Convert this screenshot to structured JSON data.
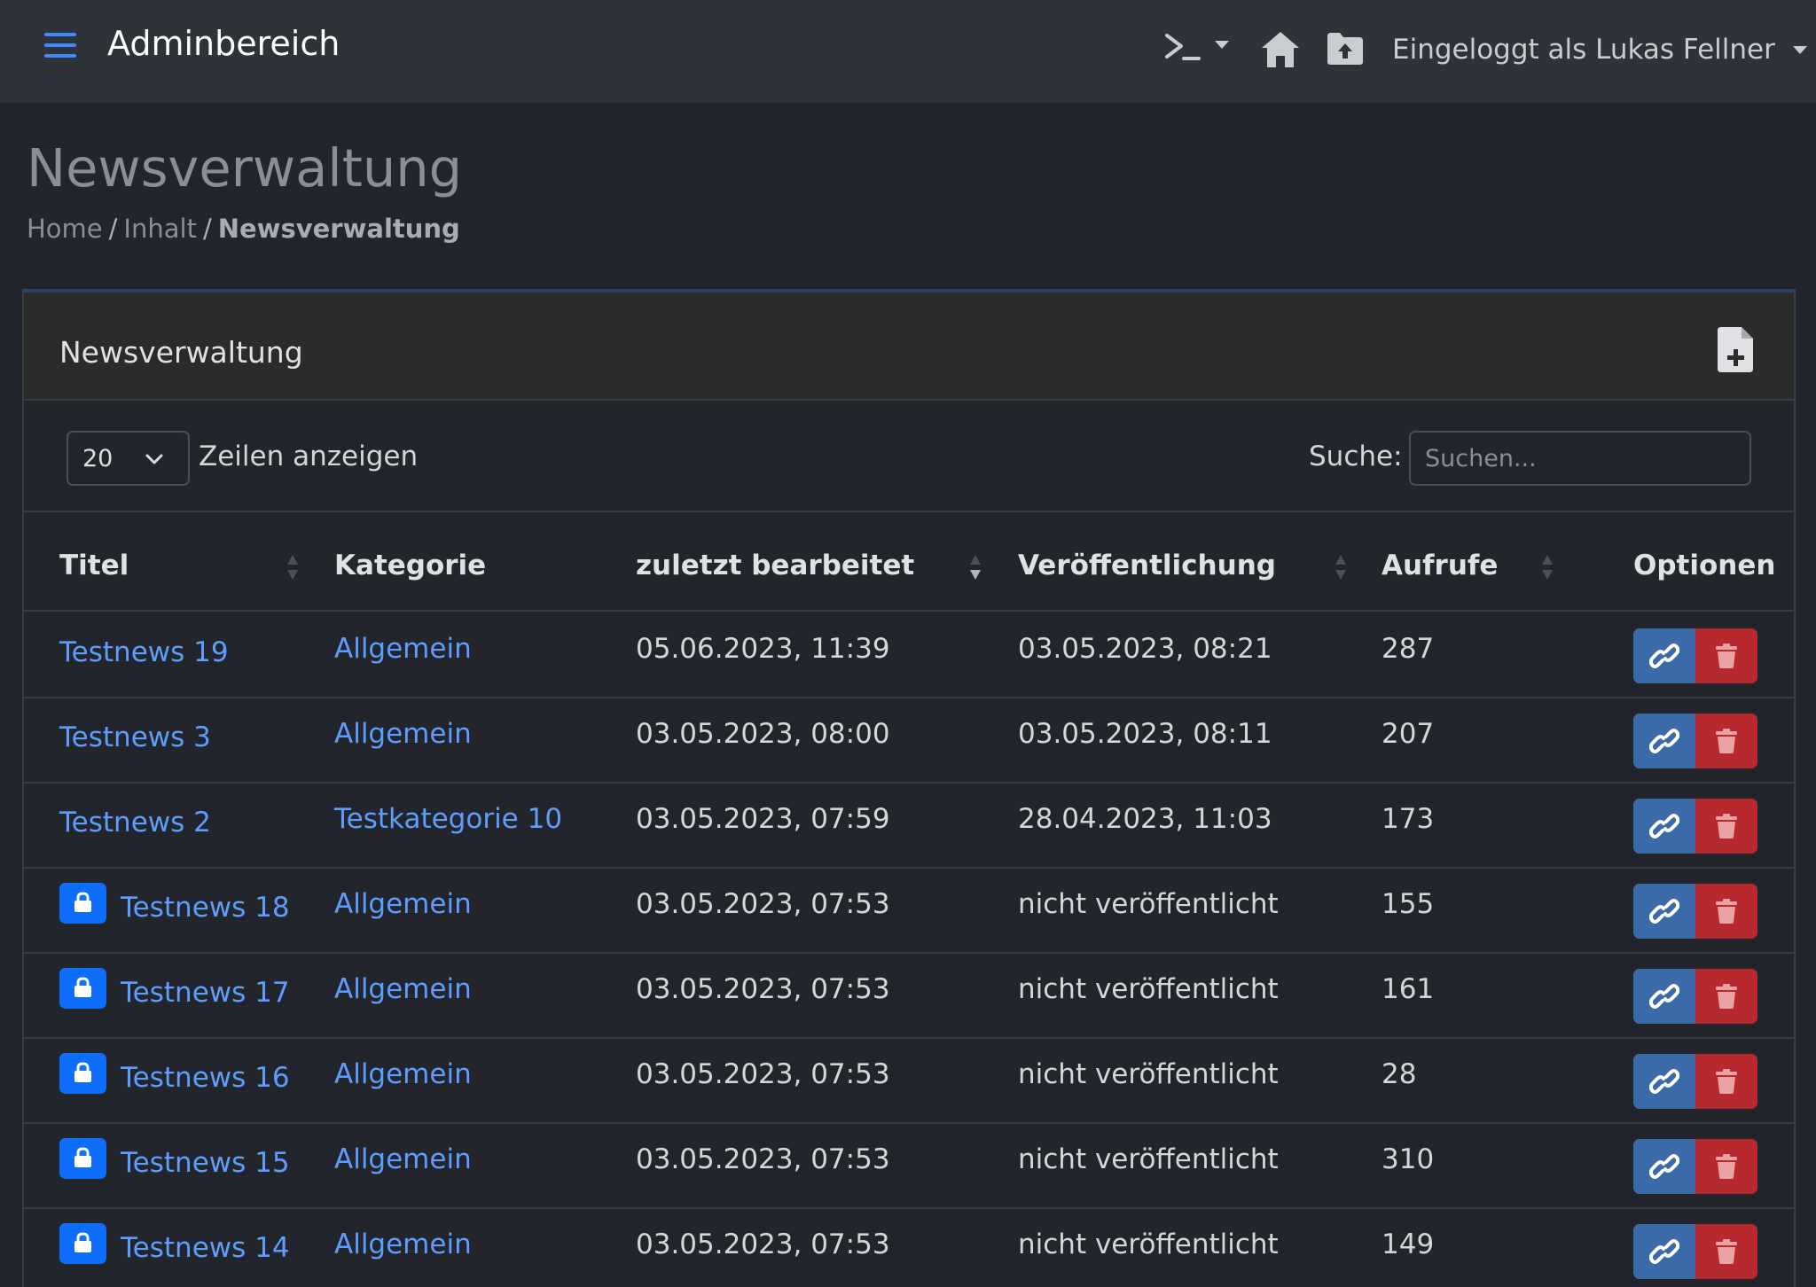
{
  "navbar": {
    "title": "Adminbereich",
    "user_label": "Eingeloggt als Lukas Fellner",
    "icons": [
      "menu-icon",
      "terminal-icon",
      "home-icon",
      "folder-upload-icon"
    ]
  },
  "page": {
    "title": "Newsverwaltung",
    "breadcrumb": [
      "Home",
      "Inhalt",
      "Newsverwaltung"
    ]
  },
  "card": {
    "title": "Newsverwaltung",
    "add_icon": "file-plus-icon"
  },
  "controls": {
    "length_value": "20",
    "length_label": "Zeilen anzeigen",
    "search_label": "Suche:",
    "search_placeholder": "Suchen...",
    "search_value": ""
  },
  "table": {
    "columns": [
      "Titel",
      "Kategorie",
      "zuletzt bearbeitet",
      "Veröffentlichung",
      "Aufrufe",
      "Optionen"
    ],
    "rows": [
      {
        "locked": false,
        "title": "Testnews 19",
        "category": "Allgemein",
        "edited": "05.06.2023, 11:39",
        "published": "03.05.2023, 08:21",
        "views": "287"
      },
      {
        "locked": false,
        "title": "Testnews 3",
        "category": "Allgemein",
        "edited": "03.05.2023, 08:00",
        "published": "03.05.2023, 08:11",
        "views": "207"
      },
      {
        "locked": false,
        "title": "Testnews 2",
        "category": "Testkategorie 10",
        "edited": "03.05.2023, 07:59",
        "published": "28.04.2023, 11:03",
        "views": "173"
      },
      {
        "locked": true,
        "title": "Testnews 18",
        "category": "Allgemein",
        "edited": "03.05.2023, 07:53",
        "published": "nicht veröffentlicht",
        "views": "155"
      },
      {
        "locked": true,
        "title": "Testnews 17",
        "category": "Allgemein",
        "edited": "03.05.2023, 07:53",
        "published": "nicht veröffentlicht",
        "views": "161"
      },
      {
        "locked": true,
        "title": "Testnews 16",
        "category": "Allgemein",
        "edited": "03.05.2023, 07:53",
        "published": "nicht veröffentlicht",
        "views": "28"
      },
      {
        "locked": true,
        "title": "Testnews 15",
        "category": "Allgemein",
        "edited": "03.05.2023, 07:53",
        "published": "nicht veröffentlicht",
        "views": "310"
      },
      {
        "locked": true,
        "title": "Testnews 14",
        "category": "Allgemein",
        "edited": "03.05.2023, 07:53",
        "published": "nicht veröffentlicht",
        "views": "149"
      }
    ]
  },
  "colors": {
    "accent": "#0d6efd",
    "link": "#5e9dfb",
    "link_button": "#3a6aa8",
    "delete_button": "#b8282f"
  }
}
